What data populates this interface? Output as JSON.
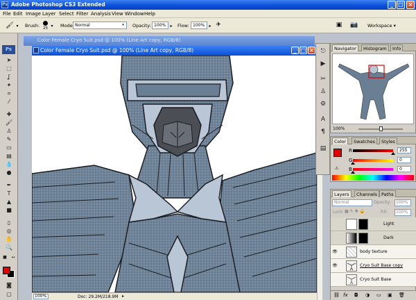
{
  "app": {
    "title": "Adobe Photoshop CS3 Extended",
    "ps_logo": "Ps",
    "win_controls": {
      "min": "_",
      "max": "□",
      "close": "×"
    }
  },
  "menu": [
    "File",
    "Edit",
    "Image",
    "Layer",
    "Select",
    "Filter",
    "Analysis",
    "View",
    "Window",
    "Help"
  ],
  "options": {
    "brush_label": "Brush:",
    "brush_size": "25",
    "mode_label": "Mode:",
    "mode_value": "Normal",
    "opacity_label": "Opacity:",
    "opacity_value": "100%",
    "flow_label": "Flow:",
    "flow_value": "100%",
    "workspace_label": "Workspace ▾"
  },
  "document": {
    "title": "Color Female Cryo Suit.psd @ 100% (Line Art copy, RGB/8)",
    "ghost_title": "Color Female Cryo Suit.psd @ 100% (Line Art copy, RGB/8)",
    "zoom": "100%",
    "doc_size": "Doc: 29.2M/218.9M"
  },
  "navigator": {
    "tabs": [
      "Navigator",
      "Histogram",
      "Info"
    ],
    "zoom": "100%"
  },
  "color_panel": {
    "tabs": [
      "Color",
      "Swatches",
      "Styles"
    ],
    "r_label": "R",
    "g_label": "G",
    "b_label": "B",
    "r_value": "255",
    "g_value": "0",
    "b_value": "0",
    "r_level": 1.0,
    "g_level": 0.0,
    "b_level": 0.0
  },
  "layers_panel": {
    "tabs": [
      "Layers",
      "Channels",
      "Paths"
    ],
    "blend": "Normal",
    "opacity_label": "Opacity:",
    "opacity_value": "100%",
    "lock_label": "Lock:",
    "fill_label": "Fill:",
    "fill_value": "100%",
    "layers": [
      {
        "name": "Light",
        "visible": false
      },
      {
        "name": "Dark",
        "visible": false
      },
      {
        "name": "body texture",
        "visible": true
      },
      {
        "name": "Cryo Suit Base copy",
        "visible": true
      },
      {
        "name": "Cryo Suit Base",
        "visible": false
      }
    ]
  },
  "colors": {
    "suit_fill": "#6b7f94",
    "suit_light": "#b9c6d6",
    "outline": "#1b1d22",
    "foreground": "#e00000",
    "background": "#000000"
  }
}
